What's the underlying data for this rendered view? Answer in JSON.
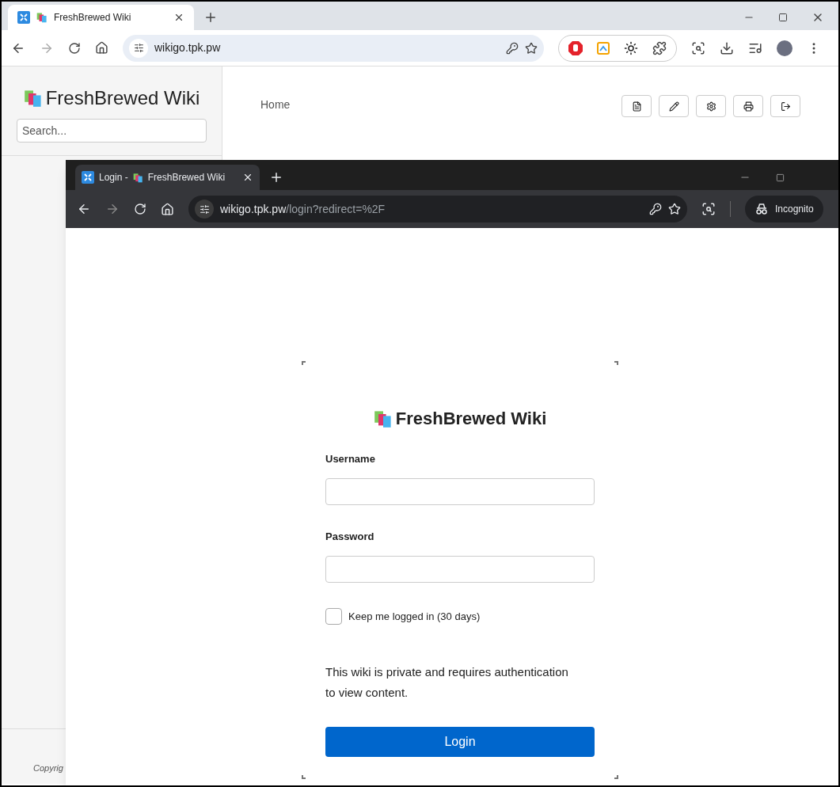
{
  "outer_browser": {
    "tab": {
      "title": "FreshBrewed Wiki",
      "selected": true
    },
    "address": "wikigo.tpk.pw"
  },
  "wiki": {
    "sidebar": {
      "title": "FreshBrewed Wiki",
      "search_placeholder": "Search...",
      "footer": "Copyrig"
    },
    "breadcrumb": "Home"
  },
  "login_window": {
    "tab": {
      "title": "Login -",
      "site": "FreshBrewed Wiki",
      "selected": true
    },
    "address": {
      "host": "wikigo.tpk.pw",
      "path": "/login?redirect=%2F"
    },
    "incognito": "Incognito",
    "form": {
      "title": "FreshBrewed Wiki",
      "fields": [
        {
          "label": "Username"
        },
        {
          "label": "Password"
        }
      ],
      "remember": {
        "label": "Keep me logged in (30 days)",
        "checked": false
      },
      "note": "This wiki is private and requires authentication to view content.",
      "button": "Login"
    }
  }
}
